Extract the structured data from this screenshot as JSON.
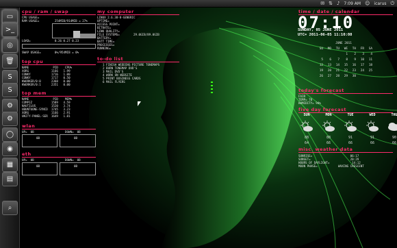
{
  "topbar": {
    "time": "7:09 AM",
    "user": "icarus",
    "icons": [
      "mail-icon",
      "network-icon",
      "volume-icon",
      "clock-icon",
      "user-icon",
      "power-icon"
    ]
  },
  "launcher": {
    "items": [
      {
        "name": "files-icon",
        "glyph": "▭"
      },
      {
        "name": "terminal-icon",
        "glyph": ">_"
      },
      {
        "name": "chrome-icon",
        "glyph": "◎"
      },
      {
        "name": "trash-icon",
        "glyph": "🗑"
      },
      {
        "name": "skype-icon",
        "glyph": "S"
      },
      {
        "name": "skype-icon-2",
        "glyph": "S"
      },
      {
        "name": "settings-icon",
        "glyph": "⚙"
      },
      {
        "name": "settings-icon-2",
        "glyph": "⚙"
      },
      {
        "name": "browser-icon",
        "glyph": "◯"
      },
      {
        "name": "system-icon",
        "glyph": "◉"
      },
      {
        "name": "photo-icon",
        "glyph": "▦"
      },
      {
        "name": "grid-icon",
        "glyph": "▤"
      },
      {
        "name": "search-icon",
        "glyph": "⌕"
      }
    ]
  },
  "sections": {
    "cpu_ram_swap": "cpu / ram / swap",
    "my_computer": "my computer",
    "time_date_calendar": "time / date / calendar",
    "top_cpu": "top cpu",
    "top_mem": "top mem",
    "to_do_list": "to-do list",
    "wlan": "wlan",
    "eth": "eth",
    "todays_forecast": "today's forecast",
    "five_day_forecast": "five day forecast",
    "misc_weather": "misc. weather data"
  },
  "cpu": {
    "lines": [
      "CPU USAGE=    ",
      "RAM USAGE=         254MIB/914MIB = 27%",
      "",
      "LOAD=              0.26 0.27 0.23",
      "",
      "SWAP USAGE=        0%/954MIB = 0%"
    ]
  },
  "my_computer": {
    "lines": [
      "LINUX 2.6.38-8-GENERIC",
      "UPTIME=",
      "ACCESS POINT=",
      "BITRATE=",
      "LINK QUALITY=",
      "FILE SYSTEMS=        29.0GIB/89.0GIB",
      "BATTERY=",
      "BATT TIME=",
      "PROCESSES=",
      "RUNNING="
    ]
  },
  "top_cpu": {
    "header": "NAME              PID    CPU%",
    "rows": [
      "XORG             1166   1.99",
      "CONKY            1716   1.00",
      "CONKY            1717   0.50",
      "KWORKER/0:0      2368   0.00",
      "KWORKER/0:1      2351   0.00"
    ]
  },
  "top_mem": {
    "header": "NAME              PID    MEM%",
    "rows": [
      "COMPIZ           1589   4.59",
      "NAUTILUS         1520   3.74",
      "UBUNTUONE-SYNCD  1745   3.23",
      "XORG             1166   2.91",
      "UNITY-PANEL-SER  1649   1.81"
    ]
  },
  "todo": {
    "items": [
      "1 FINISH WEDDING PICTURE TONEMAPS",
      "2 BURN TONEMAP DVD'S",
      "3 MAIL DVD'S",
      "4 WORK ON WEBSITE",
      "5 PRINT BUSINESS CARDS",
      "6 MAIL FLYERS"
    ]
  },
  "wlan": {
    "up": "UP=  0B",
    "down": "DOWN=  0B",
    "up_box": "0B",
    "down_box": "0B"
  },
  "eth": {
    "up": "UP=  0B",
    "down": "DOWN=  0B",
    "up_box": "0B",
    "down_box": "0B"
  },
  "clock": {
    "time": "07:10",
    "date": "SUNDAY, 05 JUNE 2011",
    "utc": "UTC= 2011-06-05 11:10:08"
  },
  "calendar": {
    "title": "JUNE 2011",
    "weekdays": [
      "SU",
      "MO",
      "TU",
      "WE",
      "TH",
      "FR",
      "SA"
    ],
    "weeks": [
      [
        "",
        "",
        "",
        "1",
        "2",
        "3",
        "4"
      ],
      [
        "5",
        "6",
        "7",
        "8",
        "9",
        "10",
        "11"
      ],
      [
        "12",
        "13",
        "14",
        "15",
        "16",
        "17",
        "18"
      ],
      [
        "19",
        "20",
        "21",
        "22",
        "23",
        "24",
        "25"
      ],
      [
        "26",
        "27",
        "28",
        "29",
        "30",
        "",
        ""
      ]
    ]
  },
  "today": {
    "condition": "FAIR",
    "temp": "TEMP= 70",
    "humidity": "HUMIDITY= 94%"
  },
  "five_day": {
    "days": [
      "SUN",
      "MON",
      "TUE",
      "WED",
      "THU"
    ],
    "highs": [
      "88",
      "88",
      "91",
      "91",
      "90"
    ],
    "lows": [
      "64",
      "66",
      "66",
      "66",
      "66"
    ],
    "icons": [
      "sun-cloud-icon",
      "sun-cloud-icon",
      "sun-cloud-icon",
      "sun-cloud-icon",
      "cloud-icon"
    ]
  },
  "misc": {
    "lines": [
      "SUNRISE=                      06:17",
      "SUNSET=                       20:29",
      "HOURS OF DAYLIGHT=             14:12",
      "MOON PHASE=            WAXING CRESCENT"
    ]
  },
  "colors": {
    "accent": "#ff2a6b",
    "green": "#39ff14"
  }
}
